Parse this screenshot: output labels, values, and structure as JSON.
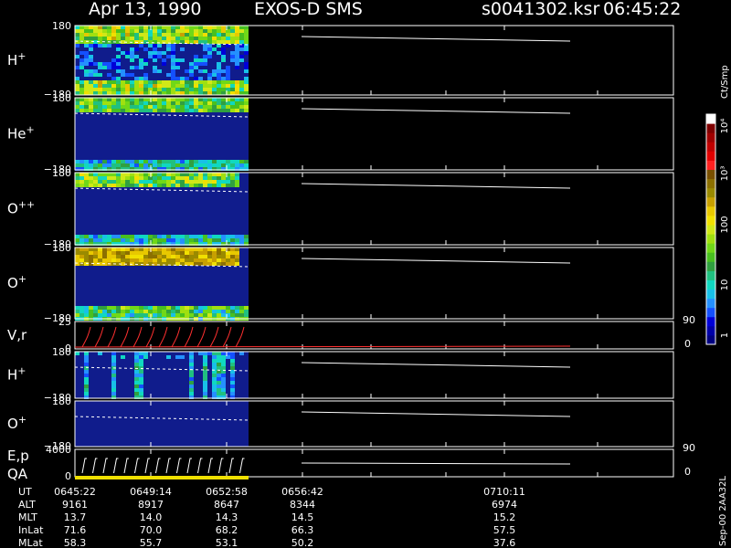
{
  "header": {
    "date": "Apr 13, 1990",
    "instrument": "EXOS-D SMS",
    "file": "s0041302.ksr",
    "time": "06:45:22"
  },
  "colorbar": {
    "title": "Ct/Smp",
    "labels": [
      "1",
      "10",
      "100",
      "10³",
      "10⁴"
    ],
    "colors": [
      "#000080",
      "#0000a8",
      "#0000d8",
      "#1450ff",
      "#2490ff",
      "#18c0e8",
      "#10d8c0",
      "#20c080",
      "#30a040",
      "#48c020",
      "#70d818",
      "#a0e010",
      "#d0e818",
      "#f0e000",
      "#e8c800",
      "#c8a000",
      "#9a8a00",
      "#8c7000",
      "#7a5000",
      "#ff2020",
      "#e00000",
      "#c00000",
      "#a00000",
      "#800000",
      "#ffffff"
    ]
  },
  "chart_data": {
    "type": "heatmap",
    "title": "Apr 13, 1990   EXOS-D SMS",
    "time_axis": {
      "tick_labels": [
        "0645:22",
        "0649:14",
        "0652:58",
        "0656:42",
        "0710:11"
      ],
      "ephemeris": [
        {
          "name": "UT",
          "values": [
            "0645:22",
            "0649:14",
            "0652:58",
            "0656:42",
            "0710:11"
          ]
        },
        {
          "name": "ALT",
          "values": [
            "9161",
            "8917",
            "8647",
            "8344",
            "6974"
          ]
        },
        {
          "name": "MLT",
          "values": [
            "13.7",
            "14.0",
            "14.3",
            "14.5",
            "15.2"
          ]
        },
        {
          "name": "InLat",
          "values": [
            "71.6",
            "70.0",
            "68.2",
            "66.3",
            "57.5"
          ]
        },
        {
          "name": "MLat",
          "values": [
            "58.3",
            "55.7",
            "53.1",
            "50.2",
            "37.6"
          ]
        }
      ]
    },
    "panels": [
      {
        "label": "H",
        "sup": "+",
        "ymax": "180",
        "ymin": "−180",
        "kind": "spectrogram",
        "pattern": "h_plus"
      },
      {
        "label": "He",
        "sup": "+",
        "ymax": "180",
        "ymin": "−180",
        "kind": "spectrogram",
        "pattern": "he_plus"
      },
      {
        "label": "O",
        "sup": "++",
        "ymax": "180",
        "ymin": "−180",
        "kind": "spectrogram",
        "pattern": "o_pp"
      },
      {
        "label": "O",
        "sup": "+",
        "ymax": "180",
        "ymin": "−180",
        "kind": "spectrogram",
        "pattern": "o_plus"
      },
      {
        "label": "V,r",
        "sup": "",
        "ymax": "25",
        "ymin": "0",
        "right_top": "90",
        "right_bottom": "0",
        "kind": "line"
      },
      {
        "label": "H",
        "sup": "+",
        "ymax": "180",
        "ymin": "−180",
        "kind": "spectrogram",
        "pattern": "h_plus2"
      },
      {
        "label": "O",
        "sup": "+",
        "ymax": "180",
        "ymin": "−180",
        "kind": "spectrogram",
        "pattern": "o_plus2"
      },
      {
        "label": "E,p",
        "label2": "QA",
        "sup": "",
        "ymax": "4000",
        "ymin": "0",
        "right_top": "90",
        "right_bottom": "0",
        "kind": "energy"
      }
    ]
  },
  "footer": {
    "stamp": "Sep-00  2AA32L"
  }
}
